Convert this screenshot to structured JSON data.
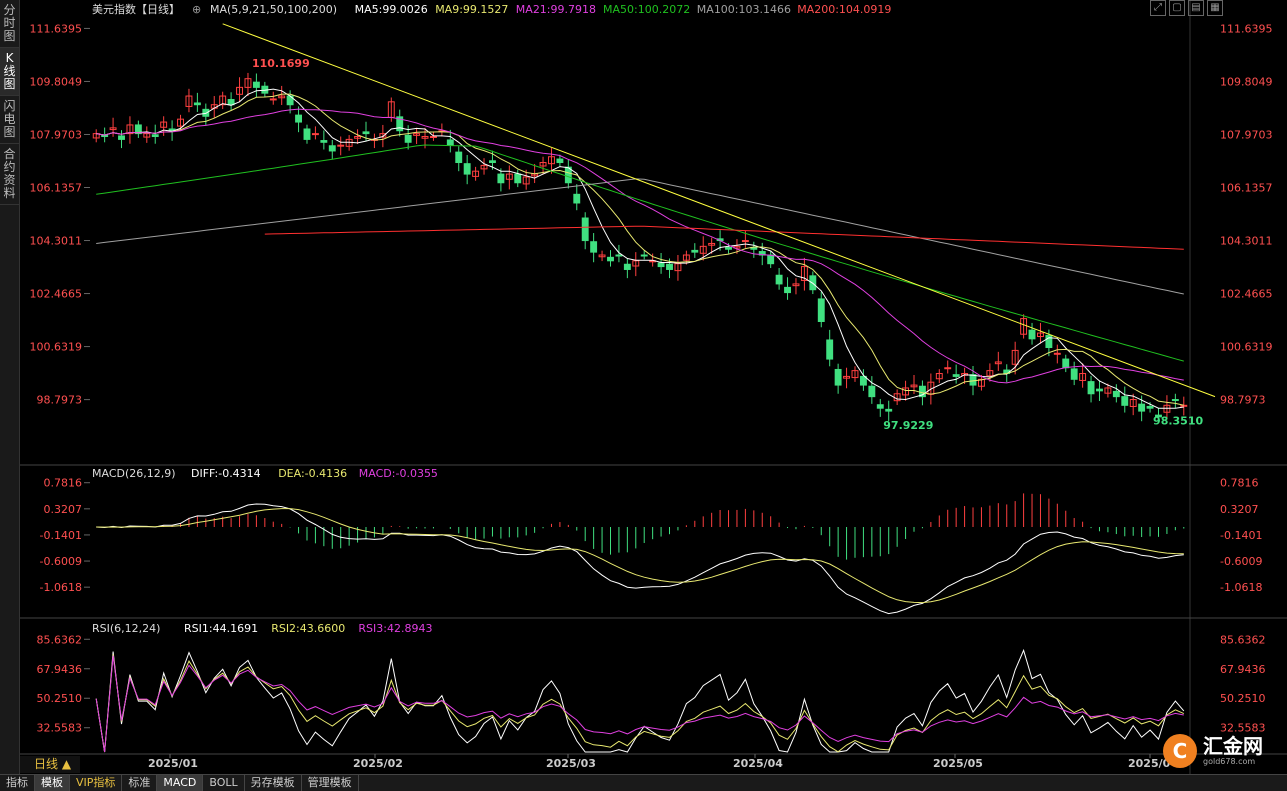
{
  "sidebar": {
    "tabs": [
      {
        "label": "分时图",
        "active": false
      },
      {
        "label": "K线图",
        "active": true
      },
      {
        "label": "闪电图",
        "active": false
      },
      {
        "label": "合约资料",
        "active": false
      }
    ]
  },
  "toolbar": {
    "icons": [
      "expand-icon",
      "window-icon",
      "layout-icon",
      "grid-icon"
    ]
  },
  "bottom_tabs": [
    {
      "label": "指标",
      "active": false,
      "vip": false
    },
    {
      "label": "模板",
      "active": true,
      "vip": false
    },
    {
      "label": "VIP指标",
      "active": false,
      "vip": true
    },
    {
      "label": "标准",
      "active": false,
      "vip": false
    },
    {
      "label": "MACD",
      "active": true,
      "vip": false
    },
    {
      "label": "BOLL",
      "active": false,
      "vip": false
    },
    {
      "label": "另存模板",
      "active": false,
      "vip": false
    },
    {
      "label": "管理模板",
      "active": false,
      "vip": false
    }
  ],
  "period_label": "日线 ▲",
  "logo": {
    "name": "汇金网",
    "url": "gold678.com",
    "mark": "C"
  },
  "colors": {
    "up": "#ff4040",
    "down": "#40e080",
    "ma5": "#ffffff",
    "ma9": "#e8e870",
    "ma21": "#e040e0",
    "ma50": "#20c020",
    "ma100": "#a0a0a0",
    "ma200": "#ff3030",
    "trend": "#ffff40",
    "axis_price": "#ff5050"
  },
  "chart_data": [
    {
      "type": "candlestick",
      "legend": {
        "name": "美元指数【日线】",
        "ma_spec": "MA(5,9,21,50,100,200)",
        "items": [
          {
            "label": "MA5:99.0026",
            "color": "#ffffff"
          },
          {
            "label": "MA9:99.1527",
            "color": "#e8e870"
          },
          {
            "label": "MA21:99.7918",
            "color": "#e040e0"
          },
          {
            "label": "MA50:100.2072",
            "color": "#20c020"
          },
          {
            "label": "MA100:103.1466",
            "color": "#a0a0a0"
          },
          {
            "label": "MA200:104.0919",
            "color": "#ff5050"
          }
        ]
      },
      "y_ticks": [
        "111.6395",
        "109.8049",
        "107.9703",
        "106.1357",
        "104.3011",
        "102.4665",
        "100.6319",
        "98.7973"
      ],
      "ylim": [
        97.4,
        112.0
      ],
      "x_ticks": [
        "2025/01",
        "2025/02",
        "2025/03",
        "2025/04",
        "2025/05",
        "2025/0"
      ],
      "annotations": [
        {
          "label": "110.1699",
          "color": "#ff5050"
        },
        {
          "label": "97.9229",
          "color": "#40e080"
        },
        {
          "label": "98.3510",
          "color": "#40e080"
        }
      ],
      "closes": [
        108.0,
        107.9,
        108.2,
        107.8,
        108.3,
        108.0,
        108.0,
        107.9,
        108.4,
        108.1,
        108.5,
        109.3,
        109.0,
        108.6,
        109.0,
        109.3,
        109.0,
        109.6,
        109.9,
        109.6,
        109.4,
        109.2,
        109.3,
        109.0,
        108.4,
        107.8,
        108.0,
        107.7,
        107.4,
        107.6,
        107.8,
        107.9,
        108.0,
        107.8,
        108.0,
        109.1,
        108.1,
        107.7,
        108.0,
        107.9,
        107.9,
        108.1,
        107.6,
        107.0,
        106.6,
        106.7,
        106.9,
        107.0,
        106.3,
        106.6,
        106.3,
        106.5,
        106.6,
        107.0,
        107.2,
        107.0,
        106.3,
        105.6,
        104.3,
        103.9,
        103.8,
        103.6,
        103.8,
        103.3,
        103.6,
        103.8,
        103.6,
        103.4,
        103.3,
        103.5,
        103.8,
        103.9,
        104.1,
        104.2,
        104.3,
        104.0,
        104.1,
        104.3,
        104.0,
        103.8,
        103.5,
        102.8,
        102.5,
        102.8,
        103.4,
        102.6,
        101.5,
        100.2,
        99.3,
        99.6,
        99.8,
        99.3,
        98.9,
        98.5,
        98.4,
        99.0,
        99.2,
        99.3,
        98.9,
        99.4,
        99.7,
        99.9,
        99.6,
        99.7,
        99.3,
        99.5,
        99.8,
        100.1,
        99.7,
        100.5,
        101.6,
        100.9,
        101.1,
        100.6,
        100.4,
        99.9,
        99.5,
        99.7,
        99.0,
        99.1,
        99.2,
        98.9,
        98.6,
        98.8,
        98.4,
        98.5,
        98.2,
        98.6,
        98.8,
        98.6
      ],
      "ma_period": [
        5,
        9,
        21,
        50,
        100,
        200
      ]
    },
    {
      "type": "line+bar",
      "legend": {
        "name": "MACD(26,12,9)",
        "items": [
          {
            "label": "DIFF:-0.4314",
            "color": "#ffffff"
          },
          {
            "label": "DEA:-0.4136",
            "color": "#e8e870"
          },
          {
            "label": "MACD:-0.0355",
            "color": "#e040e0"
          }
        ]
      },
      "y_ticks": [
        "0.7816",
        "0.3207",
        "-0.1401",
        "-0.6009",
        "-1.0618"
      ],
      "ylim": [
        -1.5,
        0.9
      ]
    },
    {
      "type": "line",
      "legend": {
        "name": "RSI(6,12,24)",
        "items": [
          {
            "label": "RSI1:44.1691",
            "color": "#ffffff"
          },
          {
            "label": "RSI2:43.6600",
            "color": "#e8e870"
          },
          {
            "label": "RSI3:42.8943",
            "color": "#e040e0"
          }
        ]
      },
      "y_ticks": [
        "85.6362",
        "67.9436",
        "50.2510",
        "32.5583"
      ],
      "ylim": [
        18,
        90
      ]
    }
  ]
}
